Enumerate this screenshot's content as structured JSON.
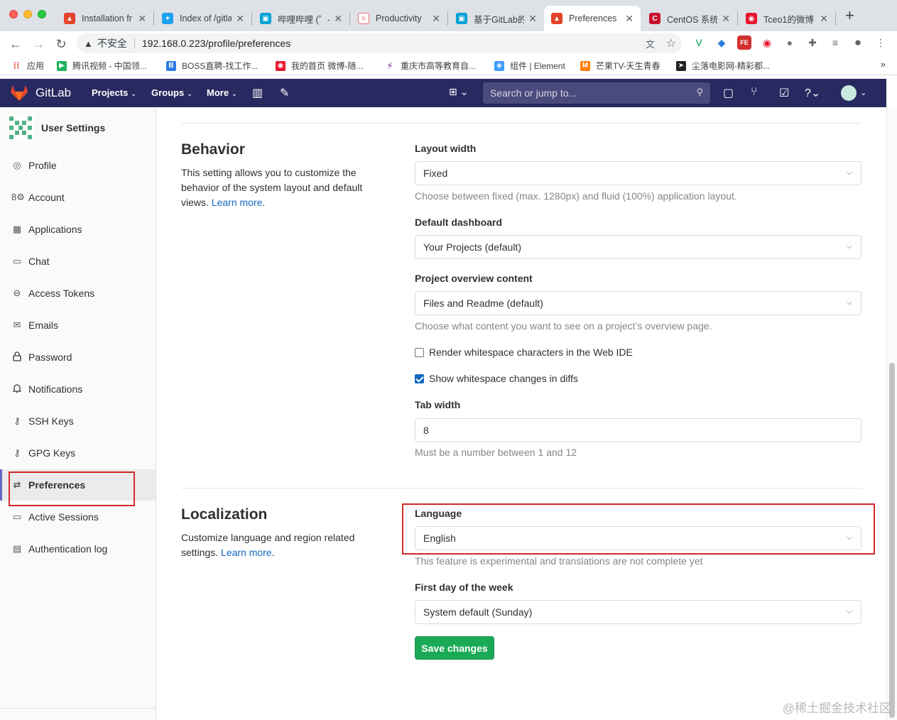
{
  "browser": {
    "tabs": [
      {
        "title": "Installation fr",
        "favicon": "gitlab-fox-icon",
        "color": "#e24329"
      },
      {
        "title": "Index of /gitla",
        "favicon": "bird-icon",
        "color": "#1da1f2"
      },
      {
        "title": "哔哩哔哩 (゜-",
        "favicon": "bilibili-icon",
        "color": "#00a1d6"
      },
      {
        "title": "Productivity",
        "favicon": "doc-icon",
        "color": "#e57373"
      },
      {
        "title": "基于GitLab的",
        "favicon": "bilibili-icon",
        "color": "#00a1d6"
      },
      {
        "title": "Preferences",
        "favicon": "gitlab-fox-icon",
        "color": "#e24329"
      },
      {
        "title": "CentOS 系统",
        "favicon": "c-icon",
        "color": "#c8102e"
      },
      {
        "title": "Tceo1的微博",
        "favicon": "weibo-icon",
        "color": "#e6162d"
      }
    ],
    "active_tab": 5,
    "address": {
      "security_label": "不安全",
      "url": "192.168.0.223/profile/preferences"
    },
    "bookmarks": [
      {
        "label": "应用",
        "icon": "apps-grid-icon",
        "color": "#ea4335"
      },
      {
        "label": "腾讯视频 - 中国领...",
        "icon": "tencent-video-icon",
        "color": "#20b45a"
      },
      {
        "label": "BOSS直聘-找工作...",
        "icon": "boss-icon",
        "color": "#2c7be5"
      },
      {
        "label": "我的首页 微博-随...",
        "icon": "weibo-icon",
        "color": "#e6162d"
      },
      {
        "label": "重庆市高等教育自...",
        "icon": "edu-icon",
        "color": "#7b1fa2"
      },
      {
        "label": "组件 | Element",
        "icon": "element-icon",
        "color": "#409eff"
      },
      {
        "label": "芒果TV-天生青春",
        "icon": "mango-tv-icon",
        "color": "#ff7e00"
      },
      {
        "label": "尘落电影网-精彩都...",
        "icon": "movie-icon",
        "color": "#222222"
      }
    ]
  },
  "gitlab": {
    "brand": "GitLab",
    "menus": [
      "Projects",
      "Groups",
      "More"
    ],
    "search_placeholder": "Search or jump to..."
  },
  "sidebar": {
    "title": "User Settings",
    "items": [
      {
        "label": "Profile",
        "icon": "profile-icon",
        "glyph": "◎"
      },
      {
        "label": "Account",
        "icon": "account-icon",
        "glyph": "8⚙"
      },
      {
        "label": "Applications",
        "icon": "applications-icon",
        "glyph": "▦"
      },
      {
        "label": "Chat",
        "icon": "chat-icon",
        "glyph": "▭"
      },
      {
        "label": "Access Tokens",
        "icon": "token-icon",
        "glyph": "⊖"
      },
      {
        "label": "Emails",
        "icon": "envelope-icon",
        "glyph": "✉"
      },
      {
        "label": "Password",
        "icon": "lock-icon",
        "glyph": "🔒"
      },
      {
        "label": "Notifications",
        "icon": "bell-icon",
        "glyph": "🔔"
      },
      {
        "label": "SSH Keys",
        "icon": "key-icon",
        "glyph": "⚷"
      },
      {
        "label": "GPG Keys",
        "icon": "key-icon",
        "glyph": "⚷"
      },
      {
        "label": "Preferences",
        "icon": "preferences-icon",
        "glyph": "⇄"
      },
      {
        "label": "Active Sessions",
        "icon": "monitor-icon",
        "glyph": "▭"
      },
      {
        "label": "Authentication log",
        "icon": "log-icon",
        "glyph": "▤"
      }
    ],
    "active_index": 10
  },
  "behavior": {
    "title": "Behavior",
    "desc": "This setting allows you to customize the behavior of the system layout and default views.",
    "learn_more": "Learn more",
    "layout_width": {
      "label": "Layout width",
      "value": "Fixed",
      "help": "Choose between fixed (max. 1280px) and fluid (100%) application layout."
    },
    "default_dashboard": {
      "label": "Default dashboard",
      "value": "Your Projects (default)"
    },
    "project_overview": {
      "label": "Project overview content",
      "value": "Files and Readme (default)",
      "help": "Choose what content you want to see on a project’s overview page."
    },
    "render_whitespace": {
      "label": "Render whitespace characters in the Web IDE",
      "checked": false
    },
    "show_whitespace": {
      "label": "Show whitespace changes in diffs",
      "checked": true
    },
    "tab_width": {
      "label": "Tab width",
      "value": "8",
      "help": "Must be a number between 1 and 12"
    }
  },
  "localization": {
    "title": "Localization",
    "desc": "Customize language and region related settings.",
    "learn_more": "Learn more",
    "language": {
      "label": "Language",
      "value": "English",
      "help": "This feature is experimental and translations are not complete yet"
    },
    "first_day": {
      "label": "First day of the week",
      "value": "System default (Sunday)"
    }
  },
  "save_label": "Save changes",
  "watermark": "@稀土掘金技术社区",
  "colors": {
    "navbar": "#292961",
    "save": "#1aaa55",
    "link": "#1068bf",
    "highlight": "#d22a2a"
  }
}
